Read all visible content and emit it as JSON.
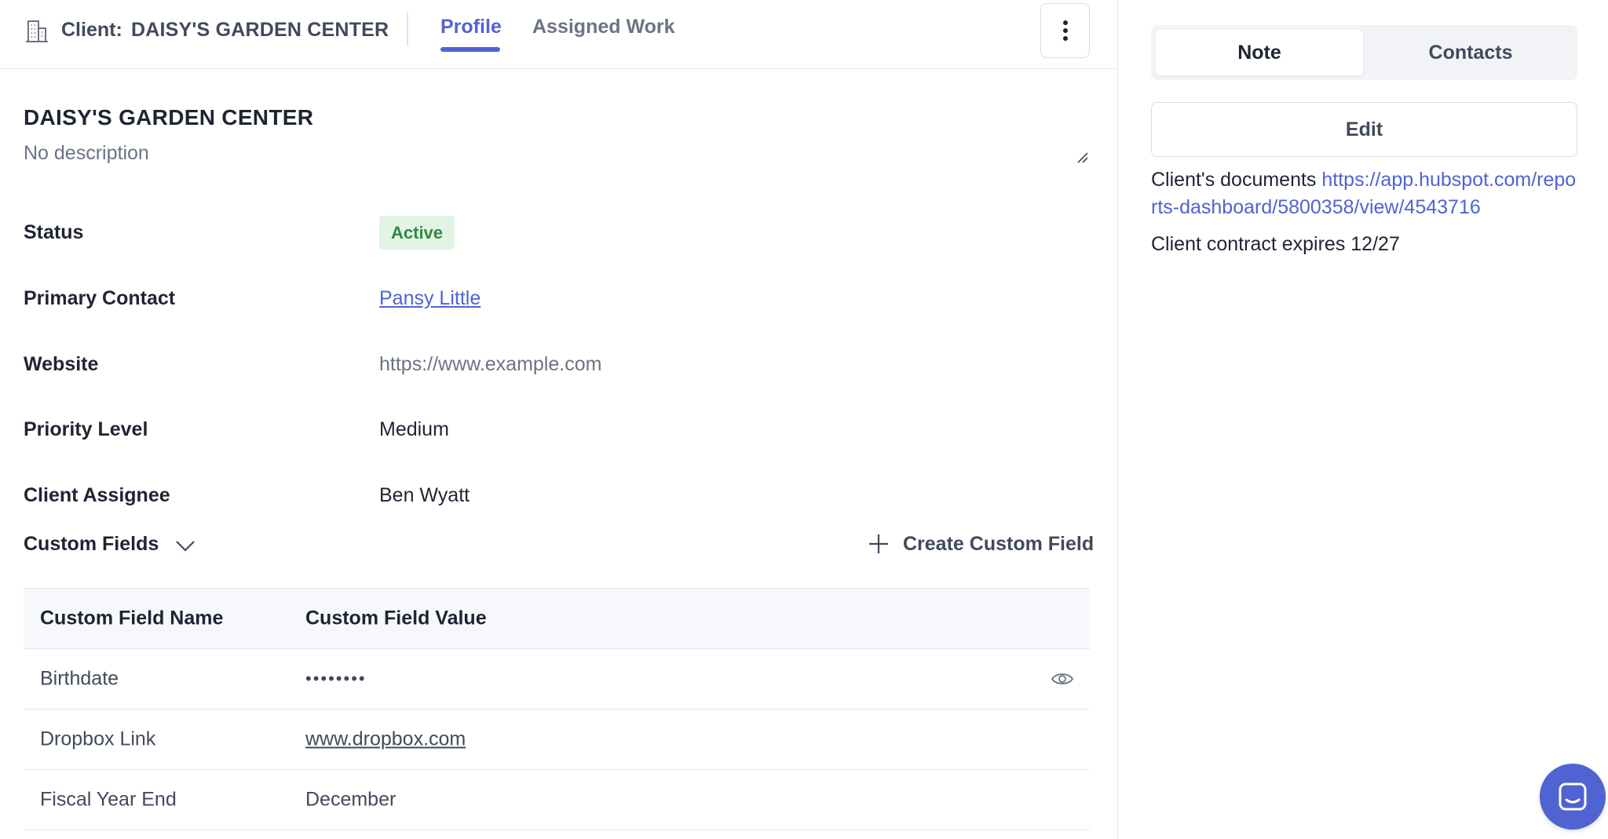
{
  "header": {
    "client_prefix": "Client:",
    "client_name": "DAISY'S GARDEN CENTER",
    "tabs": [
      {
        "label": "Profile",
        "active": true
      },
      {
        "label": "Assigned Work",
        "active": false
      }
    ]
  },
  "profile": {
    "title": "DAISY'S GARDEN CENTER",
    "description": "No description",
    "fields": {
      "status": {
        "label": "Status",
        "value": "Active"
      },
      "primary_contact": {
        "label": "Primary Contact",
        "value": "Pansy Little"
      },
      "website": {
        "label": "Website",
        "value": "https://www.example.com"
      },
      "priority": {
        "label": "Priority Level",
        "value": "Medium"
      },
      "assignee": {
        "label": "Client Assignee",
        "value": "Ben Wyatt"
      }
    }
  },
  "custom_fields": {
    "title": "Custom Fields",
    "create_label": "Create Custom Field",
    "columns": [
      "Custom Field Name",
      "Custom Field Value"
    ],
    "rows": [
      {
        "name": "Birthdate",
        "value": "••••••••"
      },
      {
        "name": "Dropbox Link",
        "value": "www.dropbox.com"
      },
      {
        "name": "Fiscal Year End",
        "value": "December"
      }
    ]
  },
  "side": {
    "tabs": [
      "Note",
      "Contacts"
    ],
    "edit_label": "Edit",
    "note_line1_text": "Client's documents ",
    "note_line1_link": "https://app.hubspot.com/reports-dashboard/5800358/view/4543716",
    "note_line2": "Client contract expires 12/27"
  },
  "colors": {
    "accent": "#4f63d2",
    "status_bg": "#e2f4e4",
    "status_fg": "#2e8a42"
  }
}
